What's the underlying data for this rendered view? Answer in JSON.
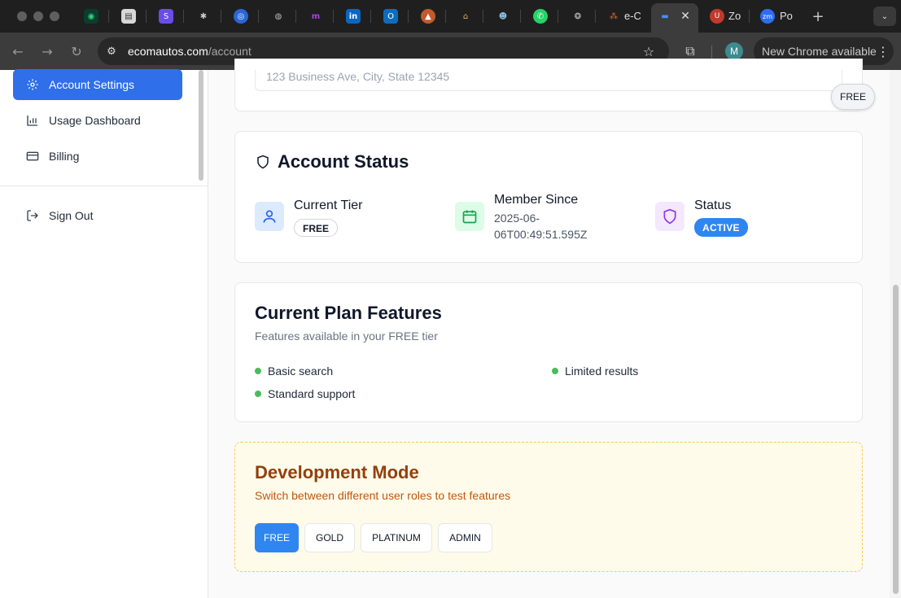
{
  "browser": {
    "tabs": [
      {
        "label": "e-C"
      },
      {
        "label": "Zo"
      },
      {
        "label": "Po"
      }
    ],
    "url_host": "ecomautos.com",
    "url_path": "/account",
    "update_label": "New Chrome available",
    "profile_initial": "M"
  },
  "sidebar": {
    "items": [
      {
        "label": "Account Settings"
      },
      {
        "label": "Usage Dashboard"
      },
      {
        "label": "Billing"
      }
    ],
    "signout": "Sign Out"
  },
  "address_card": {
    "placeholder": "123 Business Ave, City, State 12345",
    "floating_badge": "FREE"
  },
  "account_status": {
    "title": "Account Status",
    "tier_label": "Current Tier",
    "tier_value": "FREE",
    "member_label": "Member Since",
    "member_value": "2025-06-06T00:49:51.595Z",
    "status_label": "Status",
    "status_value": "ACTIVE"
  },
  "plan_features": {
    "title": "Current Plan Features",
    "subtitle": "Features available in your FREE tier",
    "items": [
      "Basic search",
      "Limited results",
      "Standard support"
    ]
  },
  "dev_mode": {
    "title": "Development Mode",
    "subtitle": "Switch between different user roles to test features",
    "roles": [
      "FREE",
      "GOLD",
      "PLATINUM",
      "ADMIN"
    ],
    "selected": "FREE"
  },
  "colors": {
    "primary": "#2f6fe9",
    "active_badge": "#2f86f0",
    "feature_dot": "#4cbb5b",
    "dev_title": "#92400e",
    "dev_background": "#fefbea"
  }
}
